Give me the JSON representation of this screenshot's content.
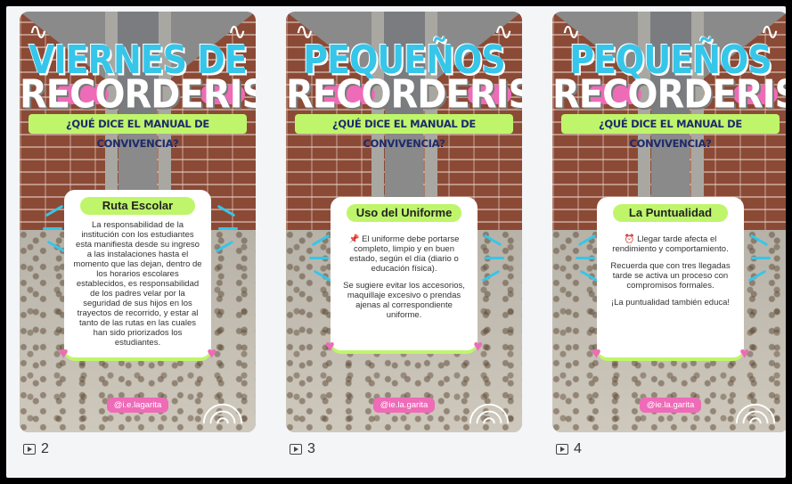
{
  "posts": [
    {
      "title_line1": "VIERNES DE",
      "title_line2": "RECORDERIS",
      "subtitle": "¿QUÉ DICE EL MANUAL DE CONVIVENCIA?",
      "section_label": "Ruta Escolar",
      "paragraphs": [
        "La responsabilidad de la institución con los estudiantes esta manifiesta desde su ingreso a las instalaciones hasta el momento que las dejan, dentro de los horarios escolares establecidos, es responsabilidad de los padres velar por la seguridad de sus hijos en los trayectos de recorrido, y estar al tanto de las rutas en las cuales han sido priorizados los estudiantes."
      ],
      "handle": "@i.e.lagarita",
      "slide_count": "2"
    },
    {
      "title_line1": "PEQUEÑOS",
      "title_line2": "RECORDERIS",
      "subtitle": "¿QUÉ DICE EL MANUAL DE CONVIVENCIA?",
      "section_label": "Uso del Uniforme",
      "paragraphs": [
        "📌 El uniforme debe portarse completo, limpio y en buen estado, según el día (diario o educación física).",
        "Se sugiere evitar los accesorios, maquillaje excesivo o prendas ajenas al correspondiente uniforme."
      ],
      "handle": "@ie.la.garita",
      "slide_count": "3"
    },
    {
      "title_line1": "PEQUEÑOS",
      "title_line2": "RECORDERIS",
      "subtitle": "¿QUÉ DICE EL MANUAL DE CONVIVENCIA?",
      "section_label": "La Puntualidad",
      "paragraphs": [
        "⏰ Llegar tarde afecta el rendimiento y comportamiento.",
        "Recuerda que con tres llegadas tarde se activa un proceso con compromisos formales.",
        "¡La puntualidad también educa!"
      ],
      "handle": "@ie.la.garita",
      "slide_count": "4"
    }
  ],
  "colors": {
    "accent_blue": "#35c6ea",
    "accent_green": "#bff56b",
    "accent_pink": "#ee6bb7",
    "brick": "#8b4a36"
  },
  "icons": {
    "carousel": "carousel-slides-icon"
  }
}
